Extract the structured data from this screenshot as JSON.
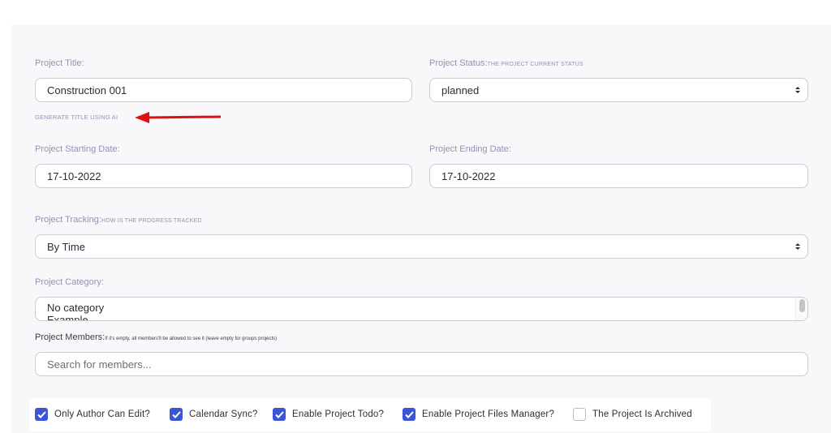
{
  "form": {
    "title": {
      "label": "Project Title:",
      "value": "Construction 001",
      "ai_link": "GENERATE TITLE USING AI"
    },
    "status": {
      "label": "Project Status:",
      "sub": "THE PROJECT CURRENT STATUS",
      "value": "planned"
    },
    "start_date": {
      "label": "Project Starting Date:",
      "value": "17-10-2022"
    },
    "end_date": {
      "label": "Project Ending Date:",
      "value": "17-10-2022"
    },
    "tracking": {
      "label": "Project Tracking:",
      "sub": "HOW IS THE PROGRESS TRACKED",
      "value": "By Time"
    },
    "category": {
      "label": "Project Category:",
      "options": [
        "No category",
        "Example"
      ]
    },
    "members": {
      "label": "Project Members:",
      "sub": "If it's empty, all members'll be allowed to see it (leave empty for groups projects)",
      "placeholder": "Search for members..."
    },
    "options": [
      {
        "label": "Only Author Can Edit?",
        "checked": true
      },
      {
        "label": "Calendar Sync?",
        "checked": true
      },
      {
        "label": "Enable Project Todo?",
        "checked": true
      },
      {
        "label": "Enable Project Files Manager?",
        "checked": true
      },
      {
        "label": "The Project Is Archived",
        "checked": false
      }
    ]
  },
  "colors": {
    "accent": "#3b55d6",
    "label": "#8f93b4",
    "annotation_arrow": "#e01010"
  },
  "icons": {
    "select": "up-down-chevron-icon",
    "check": "checkmark-icon",
    "annotation": "red-arrow-icon"
  }
}
